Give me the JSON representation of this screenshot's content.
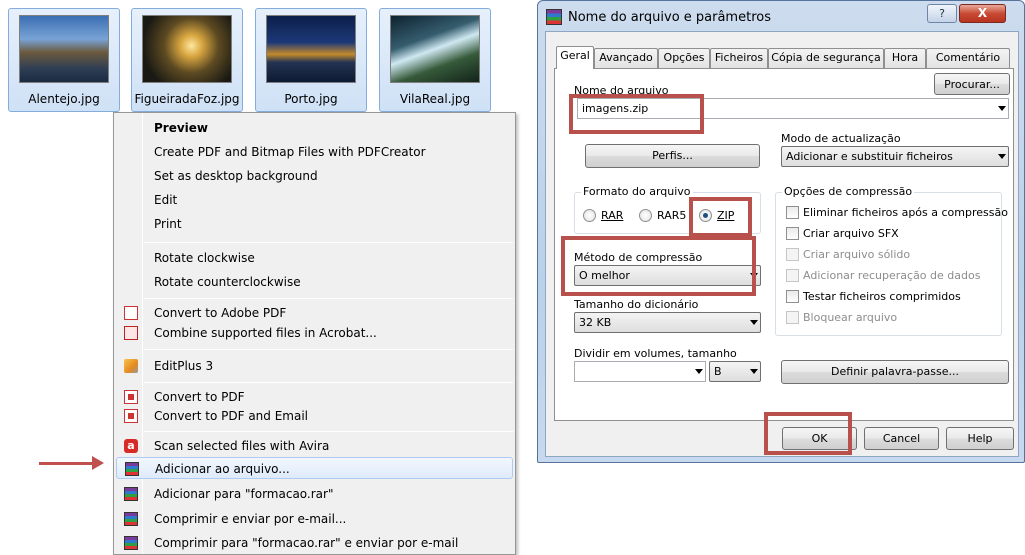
{
  "thumbnails": [
    {
      "caption": "Alentejo.jpg",
      "icon": "photo-icon"
    },
    {
      "caption": "FigueiradaFoz.jpg",
      "icon": "photo-icon"
    },
    {
      "caption": "Porto.jpg",
      "icon": "photo-icon"
    },
    {
      "caption": "VilaReal.jpg",
      "icon": "photo-icon"
    }
  ],
  "context_menu": {
    "items": [
      {
        "label": "Preview",
        "bold": true
      },
      {
        "label": "Create PDF and Bitmap Files with PDFCreator"
      },
      {
        "label": "Set as desktop background"
      },
      {
        "label": "Edit"
      },
      {
        "label": "Print"
      },
      {
        "label": "Rotate clockwise"
      },
      {
        "label": "Rotate counterclockwise"
      },
      {
        "label": "Convert to Adobe PDF",
        "icon": "adobe-pdf-icon"
      },
      {
        "label": "Combine supported files in Acrobat...",
        "icon": "acrobat-combine-icon"
      },
      {
        "label": "EditPlus 3",
        "icon": "editplus-icon"
      },
      {
        "label": "Convert to PDF",
        "icon": "pdf-convert-icon"
      },
      {
        "label": "Convert to PDF and Email",
        "icon": "pdf-email-icon"
      },
      {
        "label": "Scan selected files with Avira",
        "icon": "avira-icon"
      },
      {
        "label": "Adicionar ao arquivo...",
        "icon": "winrar-icon",
        "highlighted": true
      },
      {
        "label": "Adicionar para \"formacao.rar\"",
        "icon": "winrar-icon"
      },
      {
        "label": "Comprimir e enviar por e-mail...",
        "icon": "winrar-icon"
      },
      {
        "label": "Comprimir para \"formacao.rar\" e enviar por e-mail",
        "icon": "winrar-icon"
      }
    ]
  },
  "dialog": {
    "title": "Nome do arquivo e parâmetros",
    "help_glyph": "?",
    "close_glyph": "X",
    "tabs": [
      "Geral",
      "Avançado",
      "Opções",
      "Ficheiros",
      "Cópia de segurança",
      "Hora",
      "Comentário"
    ],
    "active_tab": "Geral",
    "archive_name_label": "Nome do arquivo",
    "archive_name_value": "imagens.zip",
    "browse_button": "Procurar...",
    "update_mode_label": "Modo de actualização",
    "update_mode_value": "Adicionar e substituir ficheiros",
    "profiles_button": "Perfis...",
    "format_group": "Formato do arquivo",
    "format_rar": "RAR",
    "format_rar5": "RAR5",
    "format_zip": "ZIP",
    "selected_format": "ZIP",
    "method_label": "Método de compressão",
    "method_value": "O melhor",
    "dict_label": "Tamanho do dicionário",
    "dict_value": "32 KB",
    "split_label": "Dividir em volumes, tamanho",
    "split_value": "",
    "split_unit": "B",
    "options_group": "Opções de compressão",
    "options": [
      {
        "label": "Eliminar ficheiros após a compressão",
        "checked": false,
        "enabled": true
      },
      {
        "label": "Criar arquivo SFX",
        "checked": false,
        "enabled": true
      },
      {
        "label": "Criar arquivo sólido",
        "checked": false,
        "enabled": false
      },
      {
        "label": "Adicionar recuperação de dados",
        "checked": false,
        "enabled": false
      },
      {
        "label": "Testar ficheiros comprimidos",
        "checked": false,
        "enabled": true
      },
      {
        "label": "Bloquear arquivo",
        "checked": false,
        "enabled": false
      }
    ],
    "password_button": "Definir palavra-passe...",
    "ok_button": "OK",
    "cancel_button": "Cancel",
    "help_button": "Help"
  },
  "colors": {
    "annotation_red": "#b8504b",
    "selection_blue": "#cfe1f6"
  }
}
